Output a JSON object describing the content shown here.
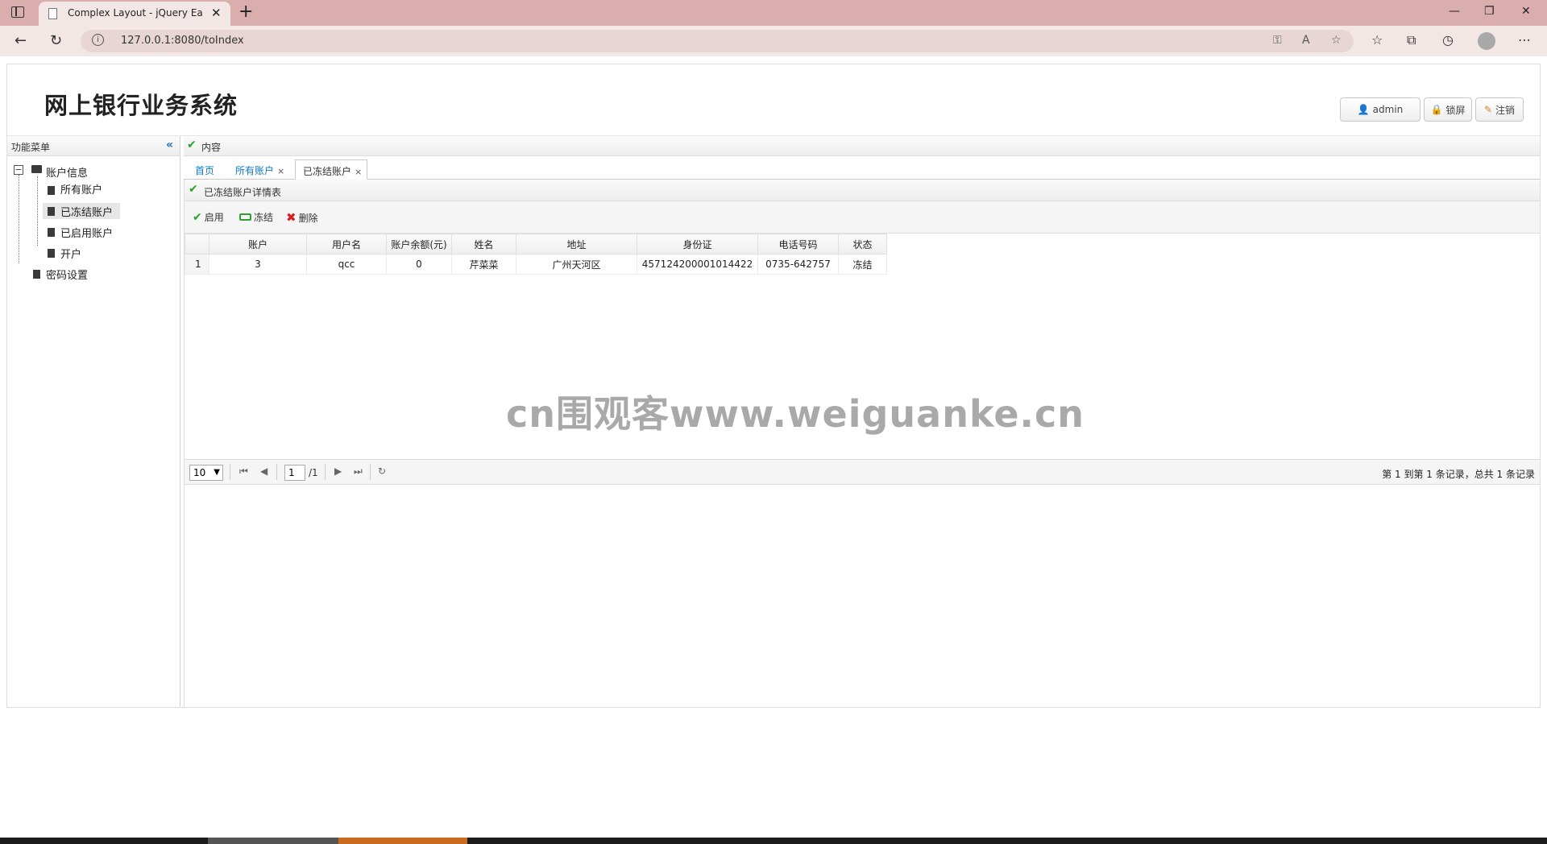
{
  "browser": {
    "tab_title": "Complex Layout - jQuery EasyUI",
    "url": "127.0.0.1:8080/toIndex"
  },
  "header": {
    "title": "网上银行业务系统",
    "buttons": {
      "user": "admin",
      "lock": "锁屏",
      "logout": "注销"
    }
  },
  "sidebar": {
    "title": "功能菜单",
    "tree": {
      "root": "账户信息",
      "children": [
        "所有账户",
        "已冻结账户",
        "已启用账户",
        "开户"
      ],
      "selected": "已冻结账户",
      "password": "密码设置"
    }
  },
  "main": {
    "title": "内容",
    "tabs": [
      {
        "label": "首页"
      },
      {
        "label": "所有账户",
        "close": "×"
      },
      {
        "label": "已冻结账户",
        "close": "×"
      }
    ],
    "grid_title": "已冻结账户详情表",
    "toolbar": {
      "enable": "启用",
      "freeze": "冻结",
      "delete": "删除"
    },
    "columns": [
      "账户",
      "用户名",
      "账户余额(元)",
      "姓名",
      "地址",
      "身份证",
      "电话号码",
      "状态"
    ],
    "rows": [
      {
        "num": "1",
        "cells": [
          "3",
          "qcc",
          "0",
          "芹菜菜",
          "广州天河区",
          "457124200001014422",
          "0735-642757",
          "冻结"
        ]
      }
    ],
    "watermark": "cn围观客www.weiguanke.cn",
    "pager": {
      "page_size": "10",
      "page": "1",
      "total_pages": "/1",
      "info": "第 1 到第 1 条记录，总共 1 条记录"
    }
  },
  "colors": {
    "accent": "#0e7ac4",
    "check": "#2fa12f",
    "delete": "#d62020",
    "browser_frame": "#d9aeac"
  }
}
